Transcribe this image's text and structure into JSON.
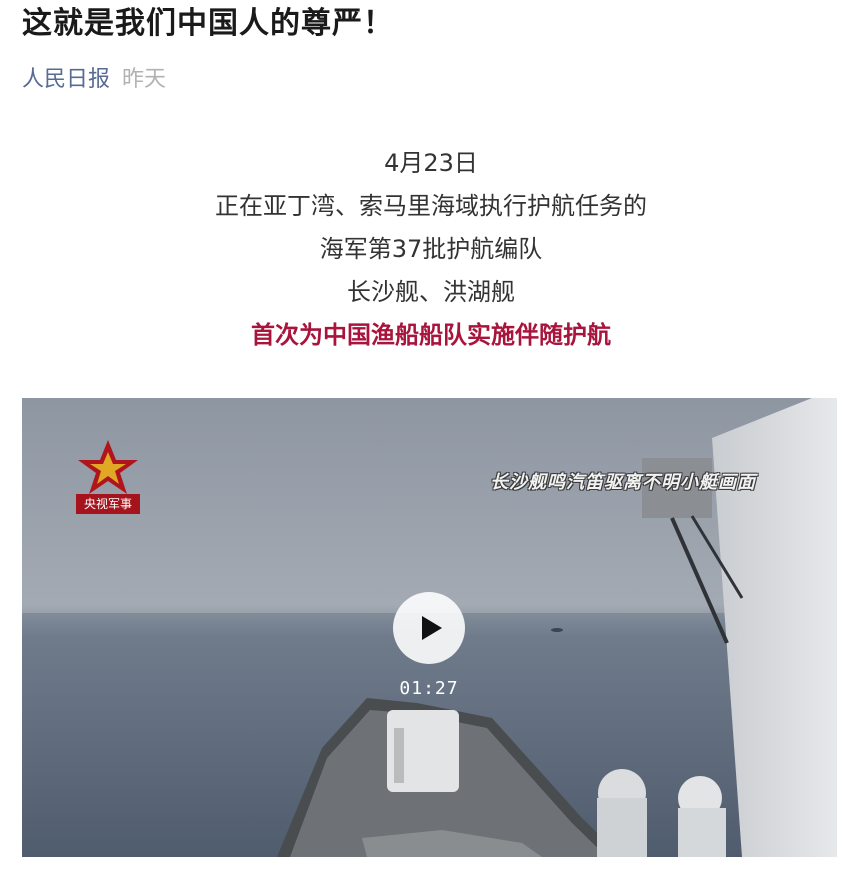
{
  "article": {
    "title": "这就是我们中国人的尊严！",
    "source": "人民日报",
    "date": "昨天"
  },
  "body_lines": [
    "4月23日",
    "正在亚丁湾、索马里海域执行护航任务的",
    "海军第37批护航编队",
    "长沙舰、洪湖舰",
    "首次为中国渔船船队实施伴随护航"
  ],
  "video": {
    "logo_text": "央视军事",
    "caption": "长沙舰鸣汽笛驱离不明小艇画面",
    "duration": "01:27",
    "play_icon": "play-icon",
    "emphasis_color": "#a8143c"
  }
}
